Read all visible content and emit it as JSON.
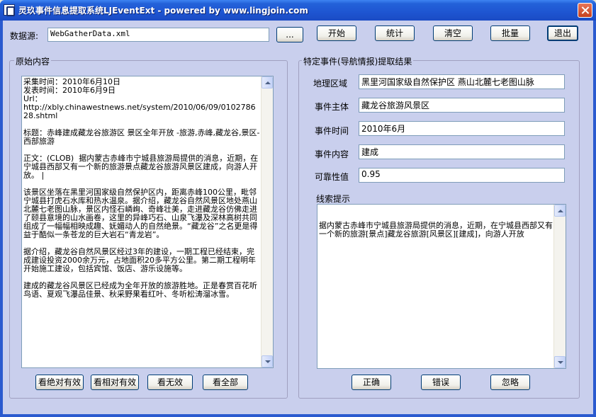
{
  "window": {
    "title": "灵玖事件信息提取系统LJEventExt - powered by www.lingjoin.com"
  },
  "toolbar": {
    "source_label": "数据源:",
    "source_value": "WebGatherData.xml",
    "browse_label": "...",
    "start_label": "开始",
    "stats_label": "统计",
    "clear_label": "清空",
    "batch_label": "批量",
    "exit_label": "退出"
  },
  "left_panel": {
    "title": "原始内容",
    "content": "采集时间：2010年6月10日\n发表时间：2010年6月9日\nUrl：\nhttp://xbly.chinawestnews.net/system/2010/06/09/010278628.shtml\n\n标题：赤峰建成藏龙谷旅游区 景区全年开放 -旅游,赤峰,藏龙谷,景区-西部旅游\n\n正文：(CLOB)  据内蒙古赤峰市宁城县旅游局提供的消息，近期，在宁城县西部又有一个新的旅游景点藏龙谷旅游风景区建成，向游人开放。 |\n\n该景区坐落在黑里河国家级自然保护区内，距离赤峰100公里，毗邻宁城县打虎石水库和热水温泉。据介绍，藏龙谷自然风景区地处燕山北麓七老图山脉，景区内怪石嶙峋、奇峰壮美，走进藏龙谷仿佛走进了颐县意境的山水画卷，这里的异峰巧石、山泉飞瀑及深林高树共同组成了一幅幅相映成趣、妩媚动人的自然绝景。“藏龙谷”之名更是得益于酷似一条苍龙的巨大岩石“青龙岩”。\n\n据介绍，藏龙谷自然风景区经过3年的建设，一期工程已经结束，完成建设投资2000余万元，占地面积20多平方公里。第二期工程明年开始施工建设，包括宾馆、饭店、游乐设施等。\n\n建成的藏龙谷风景区已经成为全年开放的旅游胜地。正是春赏百花听鸟语、夏观飞瀑品佳景、秋采野果看红叶、冬听松涛溜冰雪。",
    "buttons": {
      "absolute_label": "看绝对有效",
      "relative_label": "看相对有效",
      "invalid_label": "看无效",
      "all_label": "看全部"
    }
  },
  "right_panel": {
    "title": "特定事件(导航情报)提取结果",
    "fields": {
      "region_label": "地理区域",
      "region_value": "黑里河国家级自然保护区 燕山北麓七老图山脉",
      "subject_label": "事件主体",
      "subject_value": "藏龙谷旅游风景区",
      "time_label": "事件时间",
      "time_value": "2010年6月",
      "content_label": "事件内容",
      "content_value": "建成",
      "reliability_label": "可靠性值",
      "reliability_value": "0.95"
    },
    "clue_label": "线索提示",
    "clue_text": "据内蒙古赤峰市宁城县旅游局提供的消息，近期，在宁城县西部又有一个新的旅游[景点]藏龙谷旅游[风景区][建成]，向游人开放",
    "buttons": {
      "correct_label": "正确",
      "wrong_label": "错误",
      "ignore_label": "忽略"
    }
  },
  "colors": {
    "title_bar": "#1E55D1",
    "client_bg": "#C9CFED",
    "close_button": "#C6401E"
  }
}
